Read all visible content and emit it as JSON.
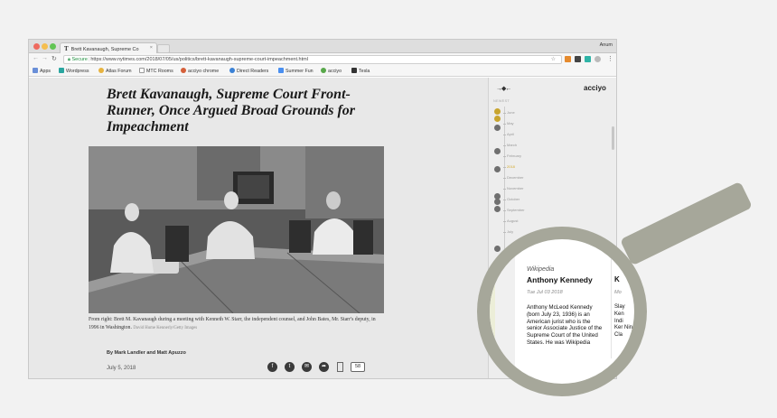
{
  "browser": {
    "tab_title": "Brett Kavanaugh, Supreme Co",
    "tab_close": "×",
    "tab_favicon": "T",
    "user_name": "Anum",
    "secure_label": "Secure",
    "url": "https://www.nytimes.com/2018/07/05/us/politics/brett-kavanaugh-supreme-court-impeachment.html",
    "bookmarks": [
      "Apps",
      "Wordpress",
      "Atlas Forum",
      "MTC Rooms",
      "acciyo chrome",
      "Direct Readers",
      "Summer Fun",
      "acciyo",
      "Tesla"
    ]
  },
  "article": {
    "headline": "Brett Kavanaugh, Supreme Court Front-Runner, Once Argued Broad Grounds for Impeachment",
    "caption": "From right: Brett M. Kavanaugh during a meeting with Kenneth W. Starr, the independent counsel, and John Bates, Mr. Starr's deputy, in 1996 in Washington.",
    "photo_credit": "David Hume Kennerly/Getty Images",
    "byline": "By Mark Landler and Matt Apuzzo",
    "date": "July 5, 2018",
    "comment_count": "58",
    "share_icons": [
      "facebook-icon",
      "twitter-icon",
      "email-icon",
      "share-icon"
    ]
  },
  "panel": {
    "brand": "acciyo",
    "newest_label": "NEWEST",
    "collapse_glyph": "→◆←",
    "timeline_labels": [
      "June",
      "May",
      "April",
      "March",
      "February",
      "2018",
      "December",
      "November",
      "October",
      "September",
      "August",
      "July"
    ],
    "accent_color": "#c8a52f"
  },
  "card": {
    "source": "Wikipedia",
    "entity": "Anthony Kennedy",
    "date": "Tue Jul 03 2018",
    "summary": "Anthony McLeod Kennedy (born July 23, 1936) is an American jurist who is the senior Associate Justice of the Supreme Court of the United States. He was Wikipedia",
    "peek_entity": "K",
    "peek_date": "Mo",
    "peek_text": "Slay Ken Indi Ker Nin Cla"
  }
}
